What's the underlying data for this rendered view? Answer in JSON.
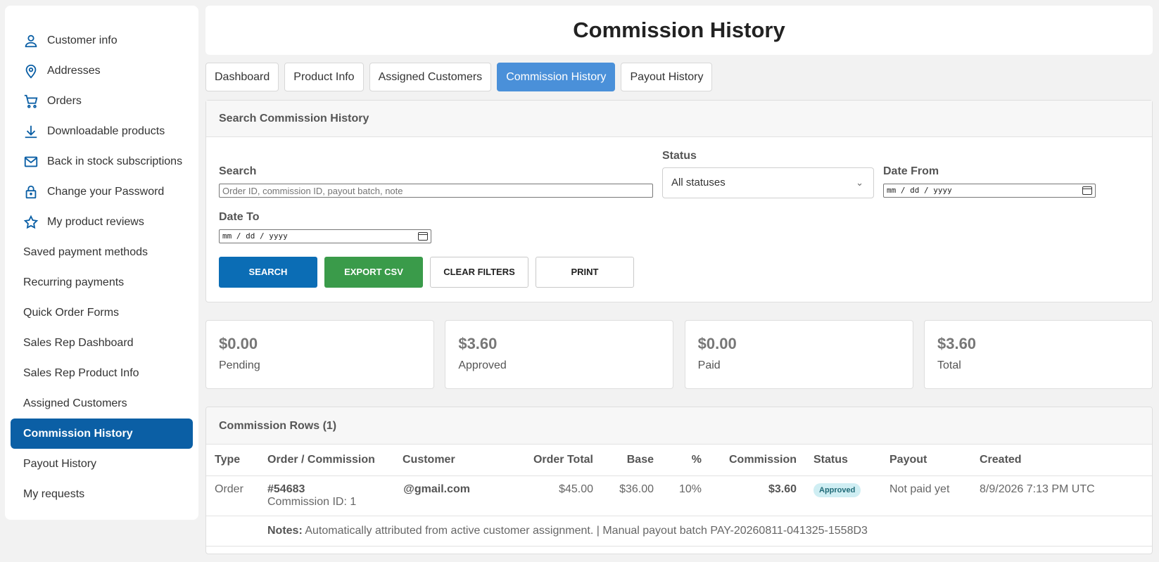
{
  "sidebar": {
    "items": [
      {
        "label": "Customer info",
        "icon": "user-icon"
      },
      {
        "label": "Addresses",
        "icon": "map-pin-icon"
      },
      {
        "label": "Orders",
        "icon": "cart-icon"
      },
      {
        "label": "Downloadable products",
        "icon": "download-icon"
      },
      {
        "label": "Back in stock subscriptions",
        "icon": "mail-icon"
      },
      {
        "label": "Change your Password",
        "icon": "lock-icon"
      },
      {
        "label": "My product reviews",
        "icon": "star-icon"
      },
      {
        "label": "Saved payment methods"
      },
      {
        "label": "Recurring payments"
      },
      {
        "label": "Quick Order Forms"
      },
      {
        "label": "Sales Rep Dashboard"
      },
      {
        "label": "Sales Rep Product Info"
      },
      {
        "label": "Assigned Customers"
      },
      {
        "label": "Commission History",
        "active": true
      },
      {
        "label": "Payout History"
      },
      {
        "label": "My requests"
      }
    ]
  },
  "page": {
    "title": "Commission History"
  },
  "tabs": [
    "Dashboard",
    "Product Info",
    "Assigned Customers",
    "Commission History",
    "Payout History"
  ],
  "search": {
    "heading": "Search Commission History",
    "search_label": "Search",
    "search_placeholder": "Order ID, commission ID, payout batch, note",
    "status_label": "Status",
    "status_value": "All statuses",
    "date_from_label": "Date From",
    "date_from_value": "mm / dd / yyyy",
    "date_to_label": "Date To",
    "date_to_value": "mm / dd / yyyy",
    "buttons": {
      "search": "SEARCH",
      "export": "EXPORT CSV",
      "clear": "CLEAR FILTERS",
      "print": "PRINT"
    }
  },
  "summary": [
    {
      "amount": "$0.00",
      "label": "Pending"
    },
    {
      "amount": "$3.60",
      "label": "Approved"
    },
    {
      "amount": "$0.00",
      "label": "Paid"
    },
    {
      "amount": "$3.60",
      "label": "Total"
    }
  ],
  "rows": {
    "heading": "Commission Rows (1)",
    "columns": [
      "Type",
      "Order / Commission",
      "Customer",
      "Order Total",
      "Base",
      "%",
      "Commission",
      "Status",
      "Payout",
      "Created"
    ],
    "data": [
      {
        "type": "Order",
        "order": "#54683",
        "commission_id": "Commission ID: 1",
        "customer": "@gmail.com",
        "order_total": "$45.00",
        "base": "$36.00",
        "percent": "10%",
        "commission": "$3.60",
        "status": "Approved",
        "payout": "Not paid yet",
        "created": "8/9/2026 7:13 PM UTC",
        "notes_label": "Notes:",
        "notes": "Automatically attributed from active customer assignment. | Manual payout batch PAY-20260811-041325-1558D3"
      }
    ]
  },
  "colors": {
    "accent": "#0b5fa5",
    "tab_active": "#4a90d9",
    "export": "#3a9b4a",
    "badge": "#cfeef3"
  }
}
